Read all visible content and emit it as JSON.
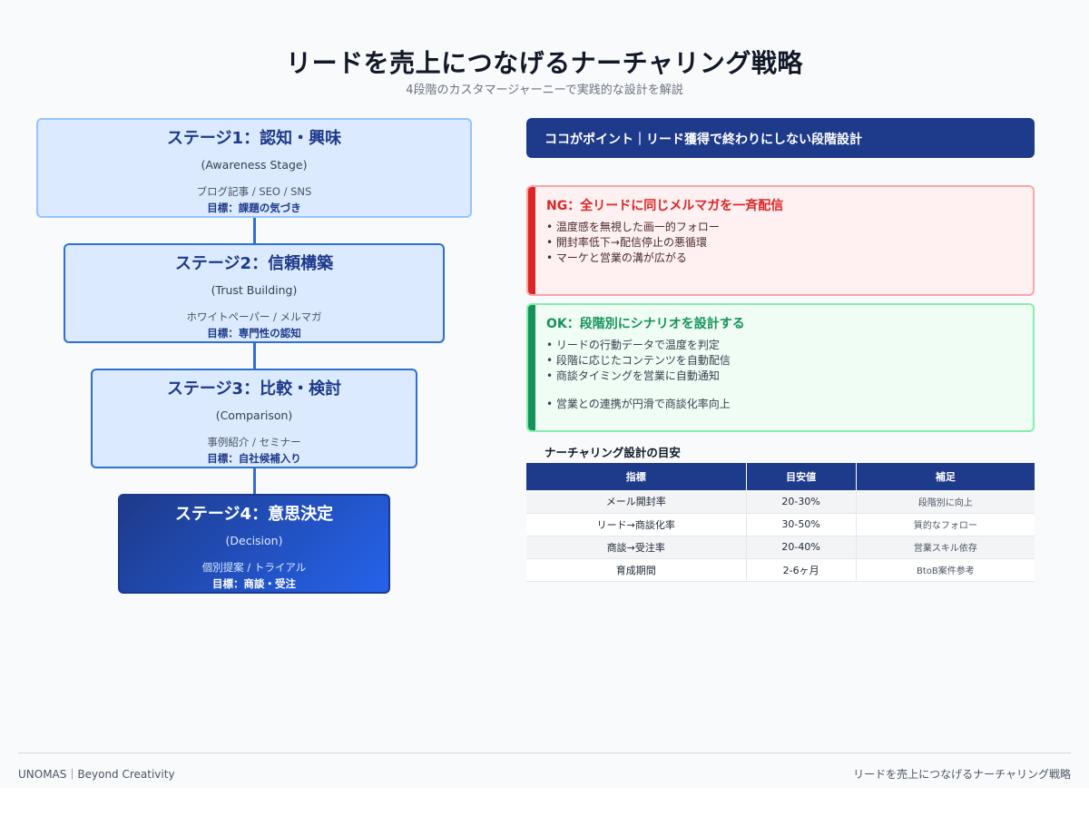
{
  "header": {
    "title": "リードを売上につなげるナーチャリング戦略",
    "subtitle": "4段階のカスタマージャーニーで実践的な設計を解説"
  },
  "stages": [
    {
      "title": "ステージ1：認知・興味",
      "en": "(Awareness Stage)",
      "media": "ブログ記事 / SEO / SNS",
      "goal": "目標：課題の気づき"
    },
    {
      "title": "ステージ2：信頼構築",
      "en": "(Trust Building)",
      "media": "ホワイトペーパー / メルマガ",
      "goal": "目標：専門性の認知"
    },
    {
      "title": "ステージ3：比較・検討",
      "en": "(Comparison)",
      "media": "事例紹介 / セミナー",
      "goal": "目標：自社候補入り"
    },
    {
      "title": "ステージ4：意思決定",
      "en": "(Decision)",
      "media": "個別提案 / トライアル",
      "goal": "目標：商談・受注"
    }
  ],
  "point_banner": "ココがポイント｜リード獲得で終わりにしない段階設計",
  "ng": {
    "title": "NG：全リードに同じメルマガを一斉配信",
    "items": [
      "温度感を無視した画一的フォロー",
      "開封率低下→配信停止の悪循環",
      "マーケと営業の溝が広がる"
    ]
  },
  "ok": {
    "title": "OK：段階別にシナリオを設計する",
    "items": [
      "リードの行動データで温度を判定",
      "段階に応じたコンテンツを自動配信",
      "商談タイミングを営業に自動通知",
      "営業との連携が円滑で商談化率向上"
    ]
  },
  "table": {
    "title": "ナーチャリング設計の目安",
    "headers": [
      "指標",
      "目安値",
      "補足"
    ],
    "rows": [
      [
        "メール開封率",
        "20-30%",
        "段階別に向上"
      ],
      [
        "リード→商談化率",
        "30-50%",
        "質的なフォロー"
      ],
      [
        "商談→受注率",
        "20-40%",
        "営業スキル依存"
      ],
      [
        "育成期間",
        "2-6ヶ月",
        "BtoB案件参考"
      ]
    ]
  },
  "footer": {
    "left": "UNOMAS｜Beyond Creativity",
    "right": "リードを売上につなげるナーチャリング戦略"
  },
  "colors": {
    "primary": "#1e3a8a",
    "stage_border": "#2f6fcf",
    "stage_fill": "#dbeafe",
    "ng": "#dc2626",
    "ok": "#15935a"
  }
}
